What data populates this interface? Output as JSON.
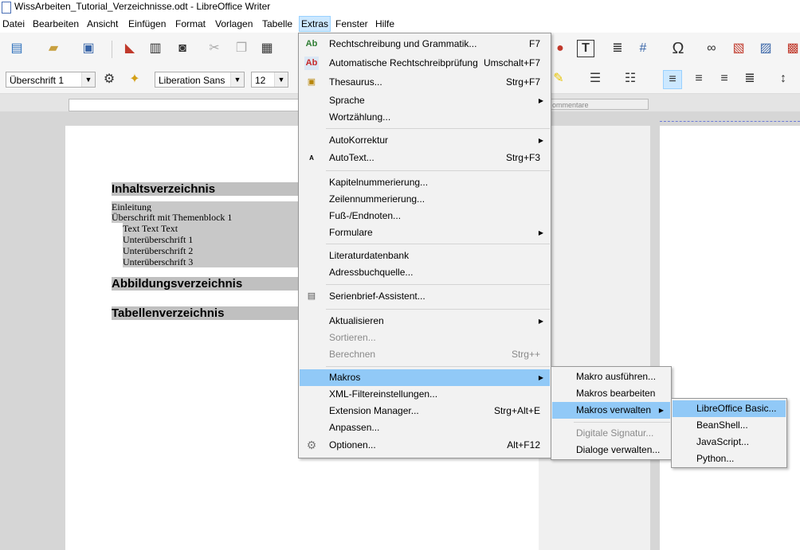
{
  "window": {
    "title": "WissArbeiten_Tutorial_Verzeichnisse.odt - LibreOffice Writer"
  },
  "menubar": [
    "Datei",
    "Bearbeiten",
    "Ansicht",
    "Einfügen",
    "Format",
    "Vorlagen",
    "Tabelle",
    "Extras",
    "Fenster",
    "Hilfe"
  ],
  "toolbar": {
    "paragraph_style": "Überschrift 1",
    "font_name": "Liberation Sans",
    "font_size": "12",
    "comment_ruler_label": "ommentare"
  },
  "document": {
    "headings": [
      "Inhaltsverzeichnis",
      "Abbildungsverzeichnis",
      "Tabellenverzeichnis"
    ],
    "toc_entries": [
      "Einleitung",
      "Überschrift mit Themenblock 1",
      "Text Text Text",
      "Unterüberschrift 1",
      "Unterüberschrift 2",
      "Unterüberschrift 3"
    ]
  },
  "extras_menu": {
    "items": [
      {
        "label": "Rechtschreibung und Grammatik...",
        "shortcut": "F7"
      },
      {
        "label": "Automatische Rechtschreibprüfung",
        "shortcut": "Umschalt+F7"
      },
      {
        "label": "Thesaurus...",
        "shortcut": "Strg+F7"
      },
      {
        "label": "Sprache",
        "shortcut": ""
      },
      {
        "label": "Wortzählung...",
        "shortcut": ""
      },
      {
        "label": "AutoKorrektur",
        "shortcut": ""
      },
      {
        "label": "AutoText...",
        "shortcut": "Strg+F3"
      },
      {
        "label": "Kapitelnummerierung...",
        "shortcut": ""
      },
      {
        "label": "Zeilennummerierung...",
        "shortcut": ""
      },
      {
        "label": "Fuß-/Endnoten...",
        "shortcut": ""
      },
      {
        "label": "Formulare",
        "shortcut": ""
      },
      {
        "label": "Literaturdatenbank",
        "shortcut": ""
      },
      {
        "label": "Adressbuchquelle...",
        "shortcut": ""
      },
      {
        "label": "Serienbrief-Assistent...",
        "shortcut": ""
      },
      {
        "label": "Aktualisieren",
        "shortcut": ""
      },
      {
        "label": "Sortieren...",
        "shortcut": ""
      },
      {
        "label": "Berechnen",
        "shortcut": "Strg++"
      },
      {
        "label": "Makros",
        "shortcut": ""
      },
      {
        "label": "XML-Filtereinstellungen...",
        "shortcut": ""
      },
      {
        "label": "Extension Manager...",
        "shortcut": "Strg+Alt+E"
      },
      {
        "label": "Anpassen...",
        "shortcut": ""
      },
      {
        "label": "Optionen...",
        "shortcut": "Alt+F12"
      }
    ]
  },
  "makros_menu": {
    "items": [
      {
        "label": "Makro ausführen..."
      },
      {
        "label": "Makros bearbeiten"
      },
      {
        "label": "Makros verwalten"
      },
      {
        "label": "Digitale Signatur..."
      },
      {
        "label": "Dialoge verwalten..."
      }
    ]
  },
  "verwalten_menu": {
    "items": [
      {
        "label": "LibreOffice Basic..."
      },
      {
        "label": "BeanShell..."
      },
      {
        "label": "JavaScript..."
      },
      {
        "label": "Python..."
      }
    ]
  },
  "colors": {
    "highlight": "#91c9f7",
    "menu_open": "#cce8ff",
    "heading_bg": "#c0c0c0"
  }
}
